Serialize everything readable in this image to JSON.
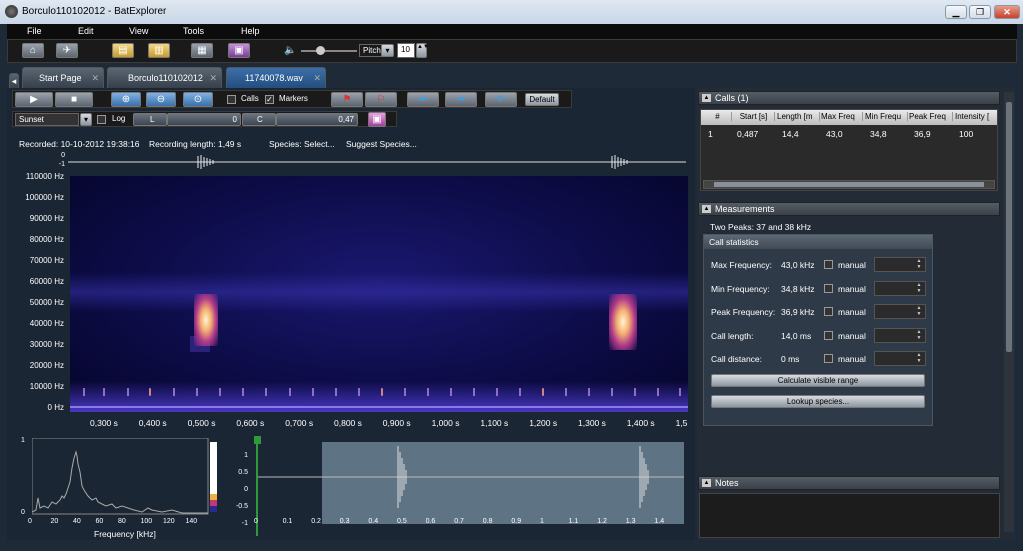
{
  "window": {
    "title": "Borculo110102012 - BatExplorer"
  },
  "menu": [
    "File",
    "Edit",
    "View",
    "Tools",
    "Help"
  ],
  "toolbar": {
    "pitch_label": "Pitch",
    "pitch_value": "10"
  },
  "tabs": [
    {
      "label": "Start Page"
    },
    {
      "label": "Borculo110102012"
    },
    {
      "label": "11740078.wav"
    }
  ],
  "viewtoolbar": {
    "calls": "Calls",
    "markers": "Markers",
    "default": "Default"
  },
  "colortoolbar": {
    "palette": "Sunset",
    "log": "Log",
    "l_label": "L",
    "l_value": "0",
    "c_label": "C",
    "c_value": "0,47"
  },
  "info": {
    "recorded": "Recorded: 10-10-2012 19:38:16",
    "length": "Recording length: 1,49 s",
    "species": "Species: Select...",
    "suggest": "Suggest Species..."
  },
  "spectrogram": {
    "y_ticks": [
      "110000 Hz",
      "100000 Hz",
      "90000 Hz",
      "80000 Hz",
      "70000 Hz",
      "60000 Hz",
      "50000 Hz",
      "40000 Hz",
      "30000 Hz",
      "20000 Hz",
      "10000 Hz",
      "0 Hz"
    ],
    "x_ticks": [
      "0,300 s",
      "0,400 s",
      "0,500 s",
      "0,600 s",
      "0,700 s",
      "0,800 s",
      "0,900 s",
      "1,000 s",
      "1,100 s",
      "1,200 s",
      "1,300 s",
      "1,400 s",
      "1,5"
    ]
  },
  "overview": {
    "y_ticks": [
      "0",
      "-1"
    ]
  },
  "spectrum": {
    "xlabel": "Frequency [kHz]",
    "x_ticks": [
      "0",
      "20",
      "40",
      "60",
      "80",
      "100",
      "120",
      "140"
    ],
    "y_ticks": [
      "1",
      "0"
    ]
  },
  "waveform": {
    "y_ticks": [
      "1",
      "0.5",
      "0",
      "-0.5",
      "-1"
    ],
    "x_ticks": [
      "0",
      "0.1",
      "0.2",
      "0.3",
      "0.4",
      "0.5",
      "0.6",
      "0.7",
      "0.8",
      "0.9",
      "1",
      "1.1",
      "1.2",
      "1.3",
      "1.4"
    ]
  },
  "calls_panel": {
    "title": "Calls (1)",
    "headers": [
      "#",
      "Start [s]",
      "Length [m",
      "Max Freq",
      "Min Frequ",
      "Peak Freq",
      "Intensity ["
    ],
    "rows": [
      [
        "1",
        "0,487",
        "14,4",
        "43,0",
        "34,8",
        "36,9",
        "100"
      ]
    ]
  },
  "measurements": {
    "title": "Measurements",
    "two_peaks": "Two Peaks: 37 and 38 kHz",
    "stats_title": "Call statistics",
    "rows": [
      {
        "label": "Max Frequency:",
        "value": "43,0 kHz",
        "manual": "manual"
      },
      {
        "label": "Min Frequency:",
        "value": "34,8 kHz",
        "manual": "manual"
      },
      {
        "label": "Peak Frequency:",
        "value": "36,9 kHz",
        "manual": "manual"
      },
      {
        "label": "Call length:",
        "value": "14,0 ms",
        "manual": "manual"
      },
      {
        "label": "Call distance:",
        "value": "0 ms",
        "manual": "manual"
      }
    ],
    "calc_button": "Calculate visible range",
    "lookup_button": "Lookup species..."
  },
  "notes": {
    "title": "Notes"
  }
}
